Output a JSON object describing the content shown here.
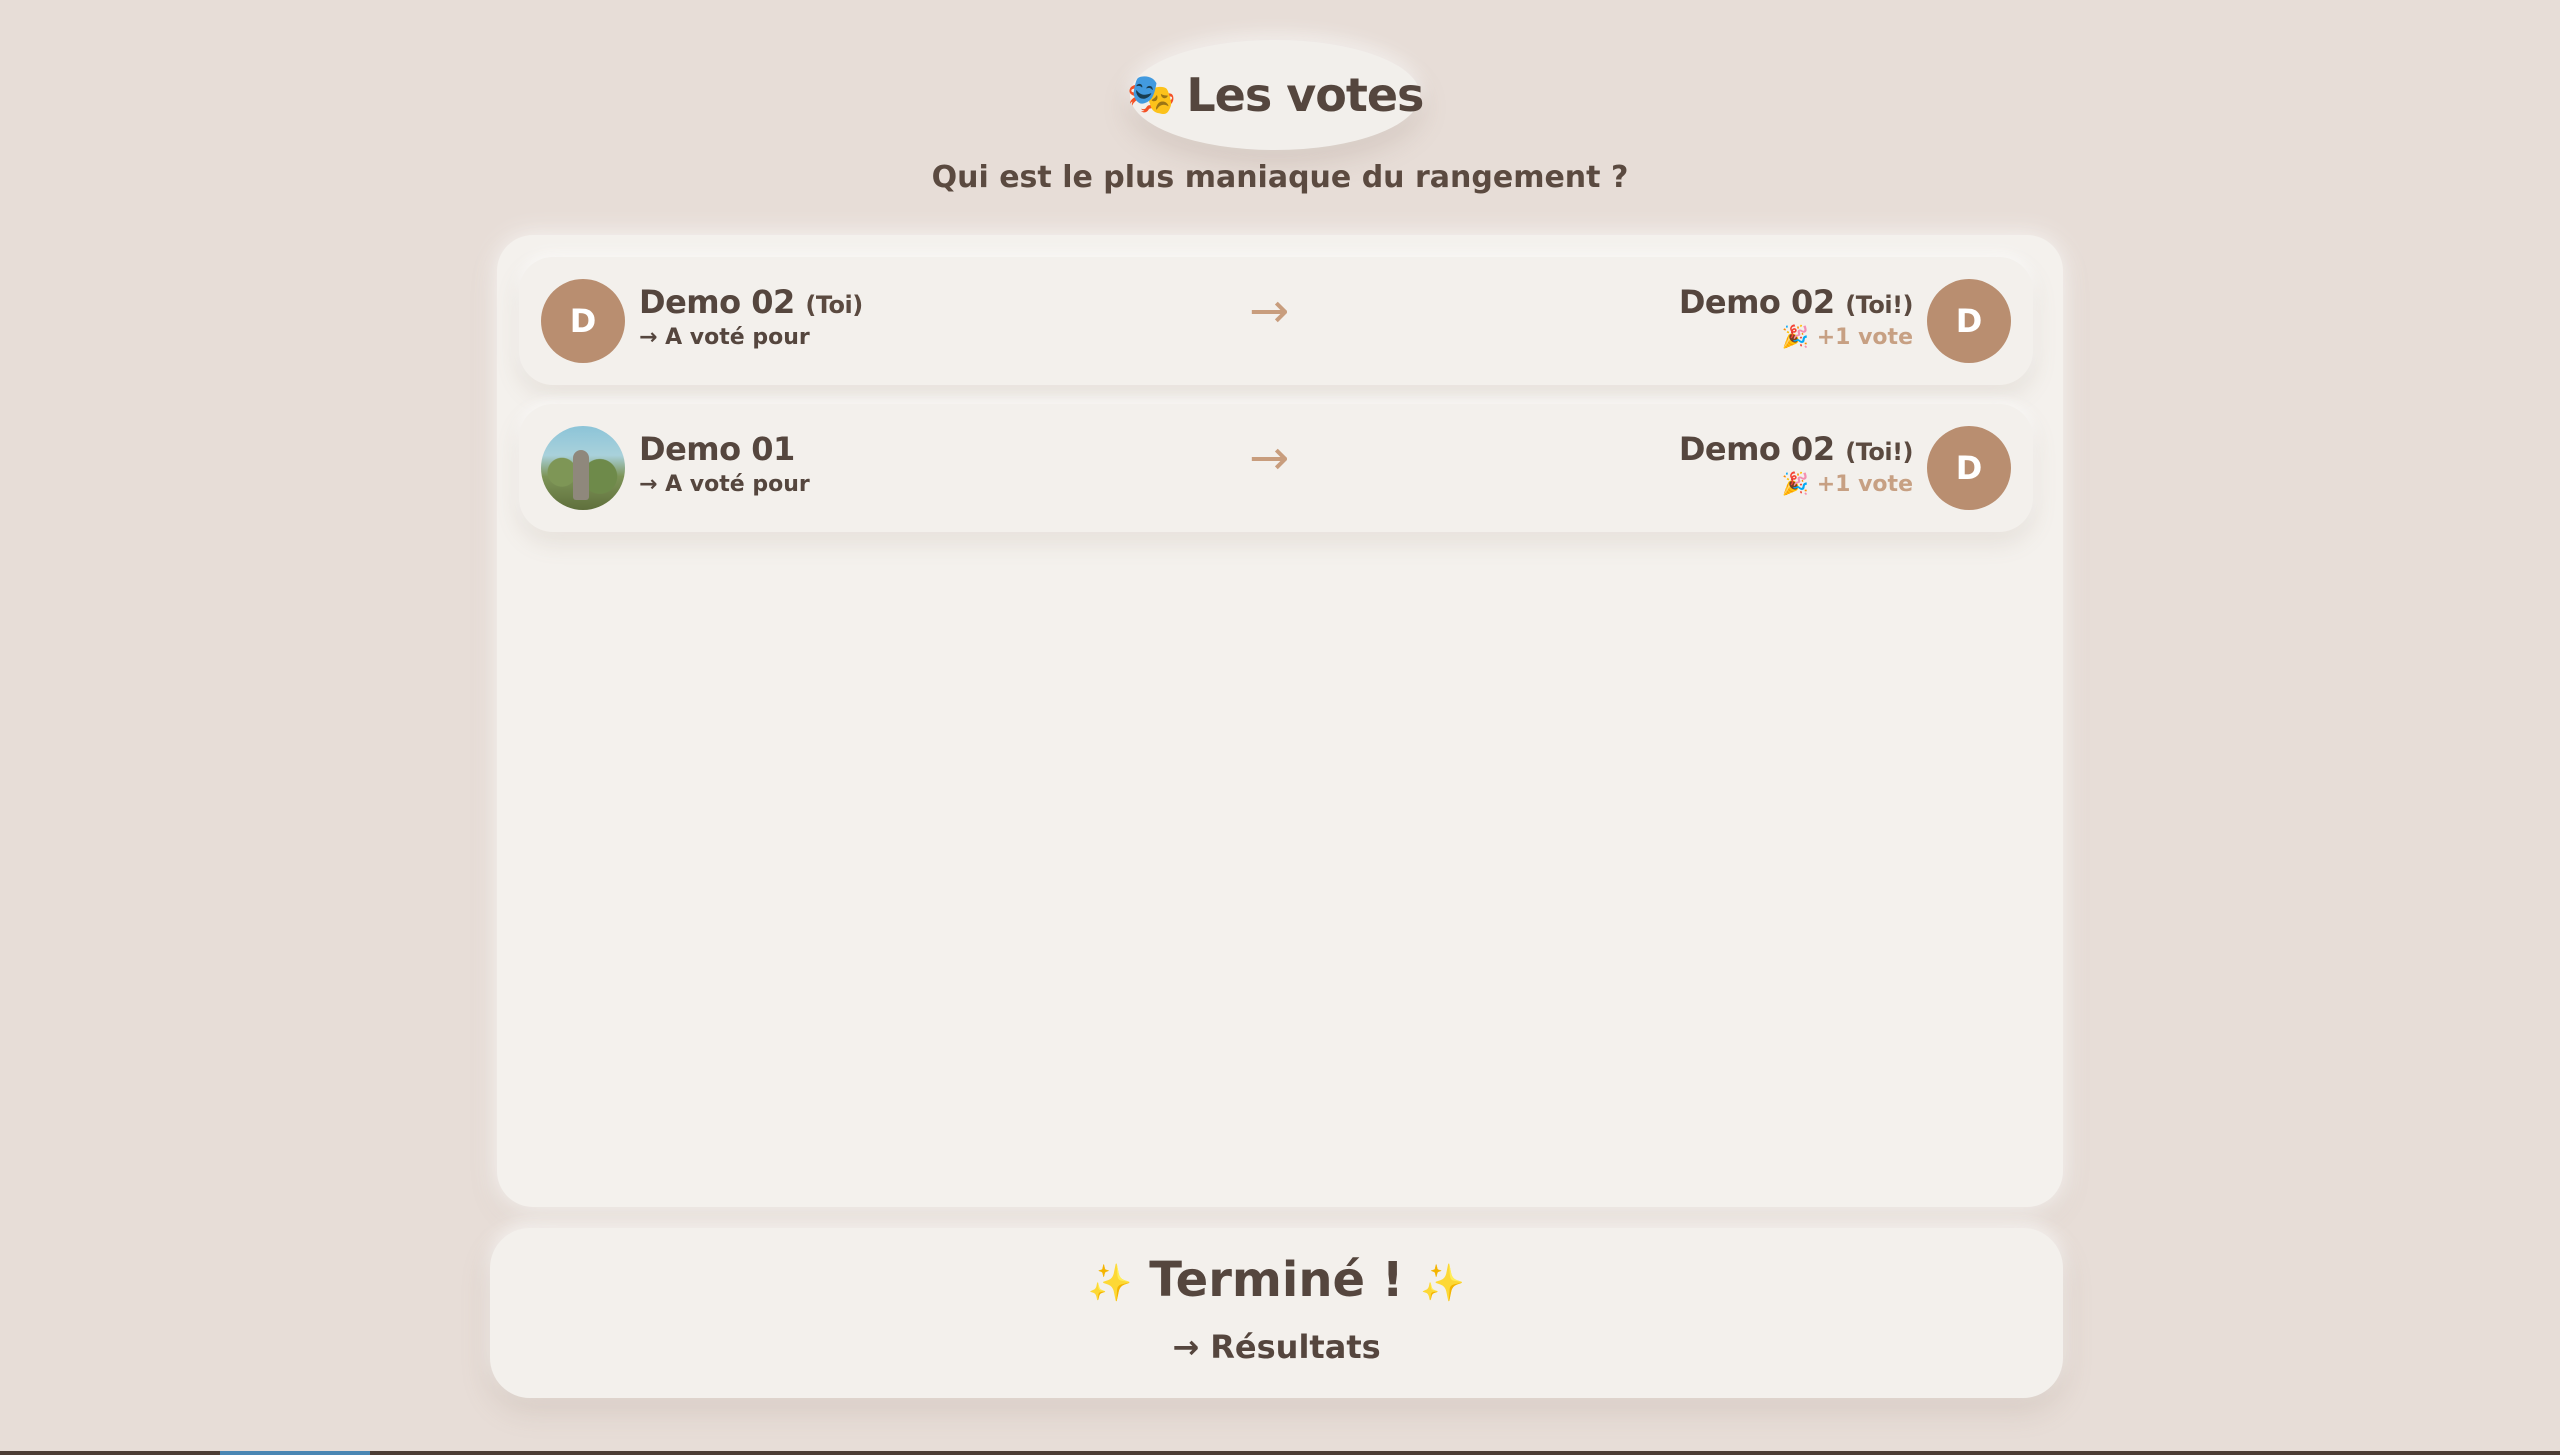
{
  "header": {
    "title_emoji": "🎭",
    "title": "Les votes",
    "question": "Qui est le plus maniaque du rangement ?"
  },
  "votes": [
    {
      "voter_initial": "D",
      "voter_name": "Demo 02",
      "voter_tag": "(Toi)",
      "action": "→ A voté pour",
      "arrow": "→",
      "target_name": "Demo 02",
      "target_tag": "(Toi!)",
      "target_initial": "D",
      "result": "🎉 +1 vote"
    },
    {
      "voter_photo": "avatar-photo",
      "voter_name": "Demo 01",
      "voter_tag": "",
      "action": "→ A voté pour",
      "arrow": "→",
      "target_name": "Demo 02",
      "target_tag": "(Toi!)",
      "target_initial": "D",
      "result": "🎉 +1 vote"
    }
  ],
  "footer": {
    "sparkle_left": "✨",
    "done_title": "Terminé !",
    "sparkle_right": "✨",
    "results_link": "→ Résultats"
  },
  "colors": {
    "background": "#e7ddd7",
    "panel": "#f4f1ed",
    "avatar": "#b98e70",
    "accent": "#c89d7d",
    "text": "#55463e"
  }
}
